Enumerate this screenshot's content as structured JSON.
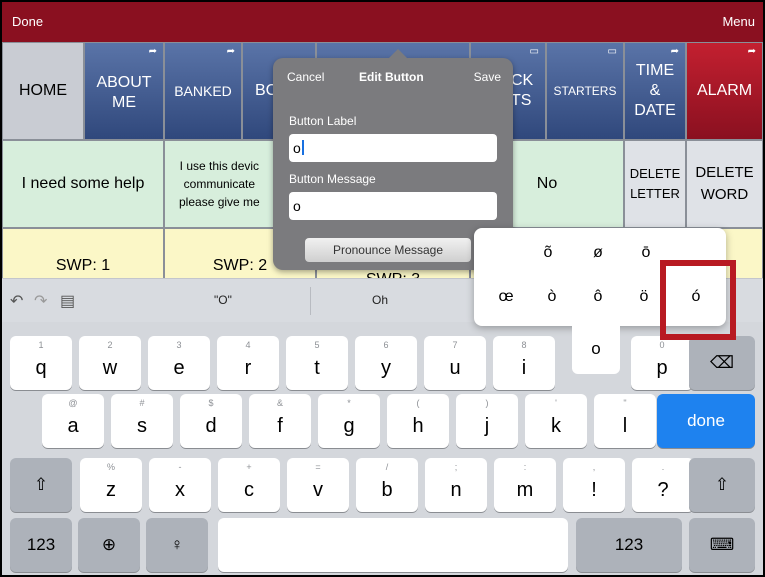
{
  "topbar": {
    "done": "Done",
    "menu": "Menu"
  },
  "nav": {
    "home": "HOME",
    "about": "ABOUT ME",
    "banked": "BANKED",
    "bo": "BC",
    "ck": "CK",
    "ts": "TS",
    "starters": "STARTERS",
    "time": "TIME & DATE",
    "alarm": "ALARM"
  },
  "row2": {
    "help": "I need some help",
    "device_l1": "I use this devic",
    "device_l2": "communicate",
    "device_l3": "please give me",
    "no": "No",
    "del_letter_1": "DELETE",
    "del_letter_2": "LETTER",
    "del_word_1": "DELETE",
    "del_word_2": "WORD"
  },
  "row3": {
    "swp1": "SWP: 1",
    "swp2": "SWP: 2",
    "swp3": "SWP: 3"
  },
  "popup": {
    "cancel": "Cancel",
    "title": "Edit Button",
    "save": "Save",
    "label_caption": "Button Label",
    "label_value": "o",
    "message_caption": "Button Message",
    "message_value": "o",
    "pronounce": "Pronounce Message"
  },
  "suggestions": {
    "s1": "\"O\"",
    "s2": "Oh"
  },
  "accents": {
    "row1": [
      "õ",
      "ø",
      "ō"
    ],
    "row2": [
      "œ",
      "ò",
      "ô",
      "ö",
      "ó"
    ],
    "base": "o"
  },
  "keyboard": {
    "row1": [
      {
        "k": "q",
        "s": "1"
      },
      {
        "k": "w",
        "s": "2"
      },
      {
        "k": "e",
        "s": "3"
      },
      {
        "k": "r",
        "s": "4"
      },
      {
        "k": "t",
        "s": "5"
      },
      {
        "k": "y",
        "s": "6"
      },
      {
        "k": "u",
        "s": "7"
      },
      {
        "k": "i",
        "s": "8"
      },
      {
        "k": "o",
        "s": ""
      },
      {
        "k": "p",
        "s": "0"
      }
    ],
    "row2": [
      {
        "k": "a",
        "s": "@"
      },
      {
        "k": "s",
        "s": "#"
      },
      {
        "k": "d",
        "s": "$"
      },
      {
        "k": "f",
        "s": "&"
      },
      {
        "k": "g",
        "s": "*"
      },
      {
        "k": "h",
        "s": "("
      },
      {
        "k": "j",
        "s": ")"
      },
      {
        "k": "k",
        "s": "'"
      },
      {
        "k": "l",
        "s": "\""
      }
    ],
    "row3": [
      {
        "k": "z",
        "s": "%"
      },
      {
        "k": "x",
        "s": "-"
      },
      {
        "k": "c",
        "s": "+"
      },
      {
        "k": "v",
        "s": "="
      },
      {
        "k": "b",
        "s": "/"
      },
      {
        "k": "n",
        "s": ";"
      },
      {
        "k": "m",
        "s": ":"
      },
      {
        "k": "!",
        "s": ","
      },
      {
        "k": "?",
        "s": "."
      }
    ],
    "done": "done",
    "num": "123",
    "num2": "123"
  }
}
